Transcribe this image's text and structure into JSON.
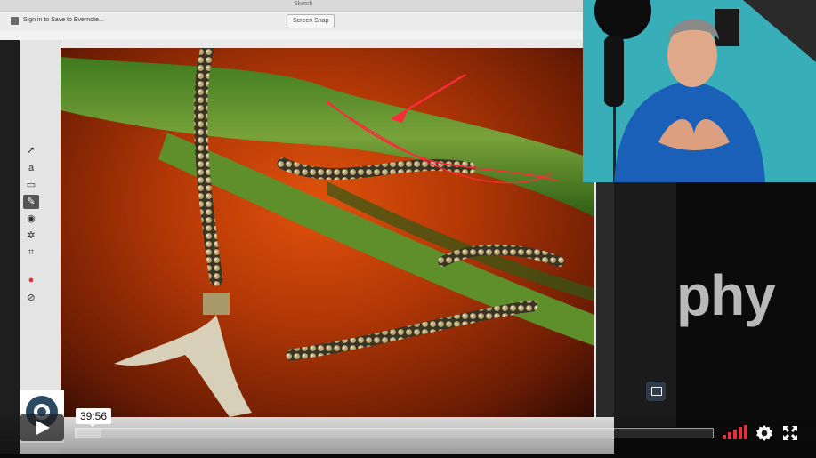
{
  "app": {
    "window_title": "Sketch",
    "signin_label": "Sign in to Save to Evernote...",
    "mode_label": "Screen Snap"
  },
  "tools": [
    {
      "id": "arrow",
      "glyph": "➚"
    },
    {
      "id": "text",
      "glyph": "a"
    },
    {
      "id": "shape",
      "glyph": "▭"
    },
    {
      "id": "marker",
      "glyph": "✎"
    },
    {
      "id": "highlighter",
      "glyph": "◉"
    },
    {
      "id": "stamp",
      "glyph": "✲"
    },
    {
      "id": "crop",
      "glyph": "⌗"
    },
    {
      "id": "color",
      "glyph": "●"
    },
    {
      "id": "size",
      "glyph": "⊘"
    }
  ],
  "backdrop": {
    "big_word": "phy"
  },
  "player": {
    "time_tooltip": "39:56",
    "progress_fraction": 0.04,
    "volume_level": 0.85
  },
  "colors": {
    "accent_red": "#e0343a",
    "annotation_red": "#ff2a3a",
    "backdrop_text": "#b9b9b9"
  }
}
